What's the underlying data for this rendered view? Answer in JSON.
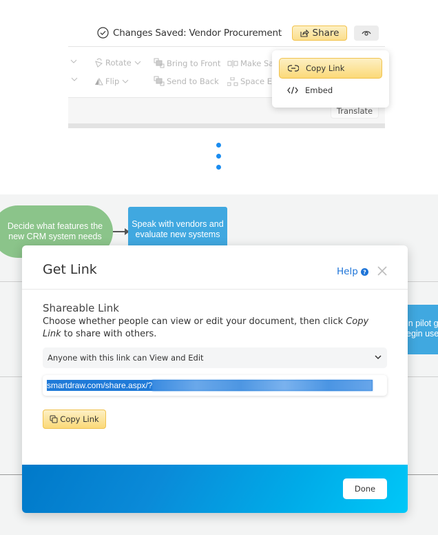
{
  "header": {
    "saved_status": "Changes Saved: Vendor Procurement",
    "share_label": "Share",
    "preview_icon": "eye-icon"
  },
  "ribbon": {
    "items": [
      {
        "label": "Rotate",
        "icon": "rotate-icon"
      },
      {
        "label": "Flip",
        "icon": "flip-icon"
      },
      {
        "label": "Bring to Front",
        "icon": "bring-to-front-icon"
      },
      {
        "label": "Send to Back",
        "icon": "send-to-back-icon"
      },
      {
        "label": "Make Sa",
        "icon": "make-same-icon"
      },
      {
        "label": "Space Ev",
        "icon": "space-evenly-icon"
      }
    ],
    "translate_label": "Translate"
  },
  "share_menu": {
    "items": [
      {
        "label": "Copy Link",
        "icon": "link-icon",
        "active": true
      },
      {
        "label": "Embed",
        "icon": "code-icon",
        "active": false
      }
    ]
  },
  "diagram": {
    "shapes": [
      {
        "text": "Decide what features the new CRM system needs",
        "color": "#8bc48a"
      },
      {
        "text": "Speak with vendors and evaluate new systems",
        "color": "#40a8e0"
      },
      {
        "text": "in pilot g\negin use",
        "color": "#40a8e0"
      }
    ]
  },
  "dialog": {
    "title": "Get Link",
    "help_label": "Help",
    "section_title": "Shareable Link",
    "description_before": "Choose whether people can view or edit your document, then click ",
    "description_em": "Copy Link",
    "description_after": " to share with others.",
    "permission_selected": "Anyone with this link can View and Edit",
    "link_value": "smartdraw.com/share.aspx/?",
    "copy_label": "Copy Link",
    "done_label": "Done"
  },
  "colors": {
    "accent_blue": "#1d74d8",
    "share_gold": "#fbd978",
    "footer_start": "#0079c9",
    "footer_end": "#00c8f8"
  }
}
